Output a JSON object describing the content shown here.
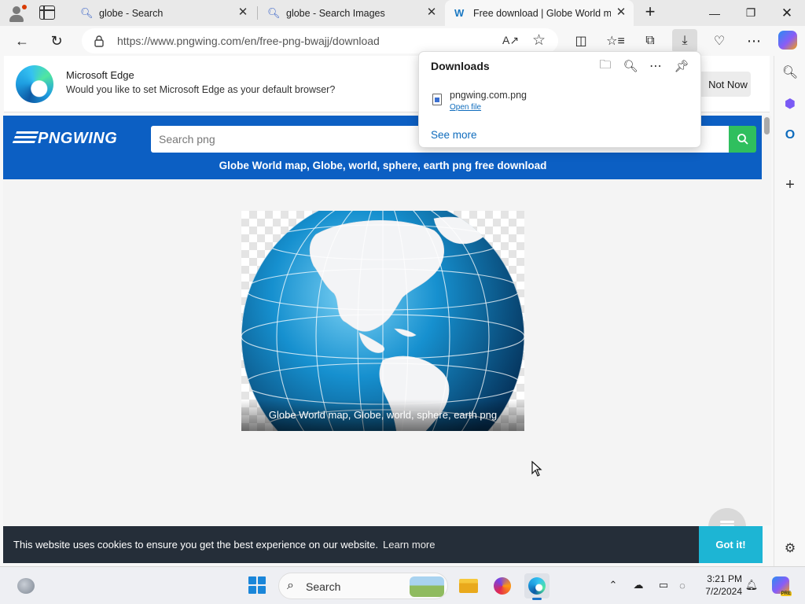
{
  "tabs": [
    {
      "title": "globe - Search",
      "icon": "search-icon",
      "active": false
    },
    {
      "title": "globe - Search Images",
      "icon": "search-icon",
      "active": false
    },
    {
      "title": "Free download | Globe World map, Globe, world, sphere, earth png",
      "icon": "pngwing-favicon-icon",
      "active": true
    }
  ],
  "address_bar": {
    "url": "https://www.pngwing.com/en/free-png-bwajj/download"
  },
  "infobar": {
    "title": "Microsoft Edge",
    "text": "Would you like to set Microsoft Edge as your default browser?",
    "not_now_label": "Not Now"
  },
  "downloads": {
    "title": "Downloads",
    "file_name": "pngwing.com.png",
    "open_file_label": "Open file",
    "see_more_label": "See more"
  },
  "site": {
    "logo_text": "PNGWING",
    "search_placeholder": "Search png",
    "page_title": "Globe World map, Globe, world, sphere, earth png free download",
    "image_caption": "Globe World map, Globe, world, sphere, earth png",
    "colors": {
      "header": "#0c5fc3",
      "search_button": "#2fbf5e",
      "cookie_bar": "#252e39",
      "got_it": "#1db5d4"
    }
  },
  "cookie_bar": {
    "text": "This website uses cookies to ensure you get the best experience on our website.",
    "learn_more_label": "Learn more",
    "got_it_label": "Got it!"
  },
  "taskbar": {
    "search_label": "Search",
    "time": "3:21 PM",
    "date": "7/2/2024",
    "copilot_badge": "PRE"
  }
}
